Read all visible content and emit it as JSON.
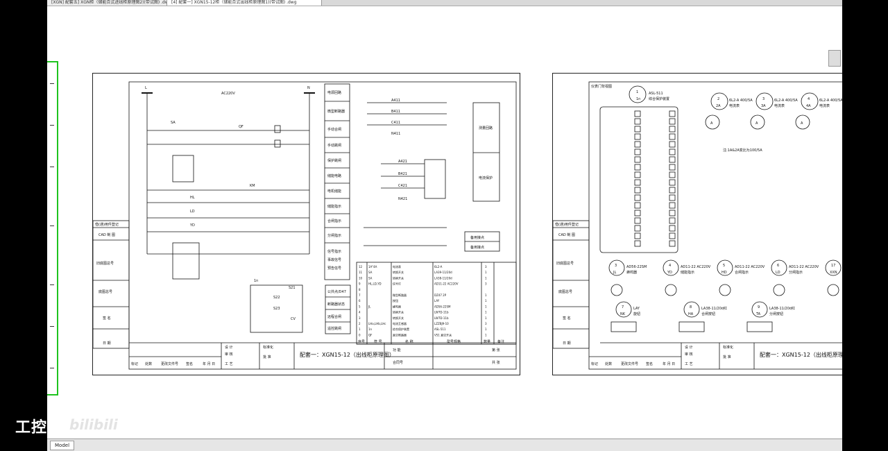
{
  "tabs": [
    {
      "label": "[XGN] 配套五] XGN柜（储能合式进线柜原理图2)(带试图) .dwg"
    },
    {
      "label": "[4] 配套一] XGN15-12柜（储能合式出线柜原理图1)(带试图) .dwg"
    }
  ],
  "bottom": {
    "model_tab": "Model"
  },
  "watermark": {
    "brand": "工控",
    "site": "bilibili"
  },
  "sheet1": {
    "bus_labels": [
      "L",
      "N",
      "AC220V"
    ],
    "side_labels": [
      "电源回路",
      "微型断路器",
      "手动合闸",
      "手动跳闸",
      "保护跳闸",
      "储能电路",
      "电机储能",
      "储能指示",
      "合闸指示",
      "分闸指示"
    ],
    "side_labels2": [
      "信号指示",
      "事故信号",
      "预告信号"
    ],
    "remote_labels": [
      "公共点/D47",
      "断路器状态",
      "远程合闸",
      "遥控跳闸"
    ],
    "right_box": [
      "测量回路",
      "电流保护"
    ],
    "backup": [
      "备用接点",
      "备用接点"
    ],
    "vert_title": [
      "借(通)用件登记",
      "CAD 制 图",
      "旧底图总号",
      "底图总号",
      "签 名",
      "日 期"
    ],
    "title_main": "配套一：XGN15-12（出线柜原理图）",
    "title_block": {
      "design": "设 计",
      "check": "审 核",
      "std": "标准化",
      "approve": "批 准",
      "craft": "工 艺",
      "ratio": "比 例",
      "pages": "共 张",
      "page": "第 张",
      "contract": "合同号",
      "func": "功 能"
    },
    "revision": [
      "标记",
      "处数",
      "更改文件号",
      "签名",
      "年 月 日"
    ],
    "parts_header": [
      "序号",
      "符 号",
      "名 称",
      "型号规格",
      "数量",
      "备注"
    ],
    "parts": [
      [
        "12",
        "1A\"4A",
        "电流表",
        "6L2-A",
        "3",
        ""
      ],
      [
        "11",
        "SA",
        "转换开关",
        "LA39-11/20d",
        "1",
        ""
      ],
      [
        "10",
        "SA",
        "转换开关",
        "LA38-11/20d",
        "1",
        ""
      ],
      [
        "9",
        "HL,LD,YD",
        "信号灯",
        "AD11-22 AC220V",
        "3",
        ""
      ],
      [
        "8",
        "",
        "",
        "",
        "",
        ""
      ],
      [
        "7",
        "",
        "微型断路器",
        "DZ47 2P",
        "1",
        ""
      ],
      [
        "6",
        "",
        "按钮",
        "LAY",
        "1",
        ""
      ],
      [
        "5",
        "JL",
        "蜂鸣器",
        "AD56-22SM",
        "1",
        ""
      ],
      [
        "4",
        "",
        "转换开关",
        "LW7D-11b",
        "1",
        ""
      ],
      [
        "3",
        "",
        "转换开关",
        "LW7D-11b",
        "1",
        ""
      ],
      [
        "2",
        "LHa,LHb,LHc",
        "电流互感器",
        "LZZBJ9-10",
        "3",
        ""
      ],
      [
        "1",
        "1n",
        "综合保护装置",
        "ASL-511",
        "1",
        ""
      ],
      [
        "0",
        "QF",
        "真空断路器",
        "VS1 真空开关",
        "1",
        ""
      ]
    ],
    "ct_labels": [
      "A411",
      "B411",
      "C411",
      "N411",
      "A421",
      "B421",
      "C421",
      "N421"
    ],
    "lamp_labels": [
      "HL",
      "LD",
      "YD"
    ],
    "misc": [
      "1n",
      "SA",
      "QF",
      "KM",
      "CV",
      "S21",
      "S22",
      "S23"
    ]
  },
  "sheet2": {
    "title": "仪表门背视图",
    "device1": {
      "num": "1",
      "code": "1n",
      "model": "ASL-511",
      "name": "综合保护装置"
    },
    "meters": [
      {
        "num": "2",
        "code": "2A",
        "model": "6L2-A 400/5A",
        "name": "电流表"
      },
      {
        "num": "3",
        "code": "3A",
        "model": "6L2-A 400/5A",
        "name": "电流表"
      },
      {
        "num": "4",
        "code": "4A",
        "model": "6L2-A 400/5A",
        "name": "电流表"
      }
    ],
    "note": "注:1A&2A变比为100/5A",
    "devices_row2": [
      {
        "num": "3",
        "code": "JL",
        "model": "AD56-22SM",
        "name": "蜂鸣器"
      },
      {
        "num": "4",
        "code": "YD",
        "model": "AD11-22 AC220V",
        "name": "储能指示"
      },
      {
        "num": "5",
        "code": "HD",
        "model": "AD11-22 AC220V",
        "name": "合闸指示"
      },
      {
        "num": "6",
        "code": "LD",
        "model": "AD11-22 AC220V",
        "name": "分闸指示"
      },
      {
        "num": "17",
        "code": "XXN",
        "model": "",
        "name": ""
      }
    ],
    "devices_row3": [
      {
        "num": "7",
        "code": "NK",
        "model": "LAY",
        "name": "旋钮"
      },
      {
        "num": "8",
        "code": "HA",
        "model": "LA38-11/20d红",
        "name": "合闸按钮"
      },
      {
        "num": "9",
        "code": "TA",
        "model": "LA38-11/20d红",
        "name": "分闸按钮"
      }
    ],
    "vert_title": [
      "借(通)用件登记",
      "CAD 制 图",
      "旧底图总号",
      "底图总号",
      "签 名",
      "日 期"
    ],
    "title_main": "配套一：XGN15-12（出线柜原理",
    "title_block": {
      "design": "设 计",
      "check": "审 核",
      "std": "标准化",
      "approve": "批 准",
      "craft": "工 艺"
    },
    "revision": [
      "标记",
      "处数",
      "更改文件号",
      "签名",
      "年 月 日"
    ]
  }
}
